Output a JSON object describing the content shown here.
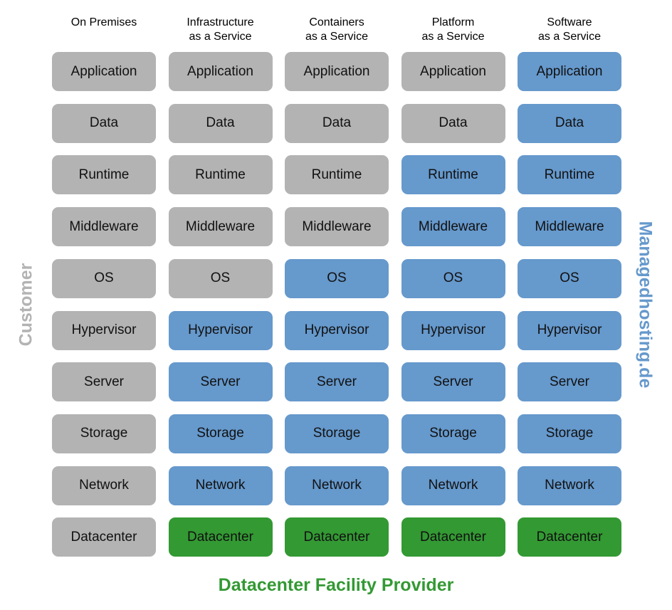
{
  "colors": {
    "customer": "#b3b3b3",
    "provider": "#6699cc",
    "facility": "#339933"
  },
  "columns": [
    {
      "title": [
        "On Premises"
      ],
      "cells": [
        "customer",
        "customer",
        "customer",
        "customer",
        "customer",
        "customer",
        "customer",
        "customer",
        "customer",
        "customer"
      ]
    },
    {
      "title": [
        "Infrastructure",
        "as a Service"
      ],
      "cells": [
        "customer",
        "customer",
        "customer",
        "customer",
        "customer",
        "provider",
        "provider",
        "provider",
        "provider",
        "facility"
      ]
    },
    {
      "title": [
        "Containers",
        "as a Service"
      ],
      "cells": [
        "customer",
        "customer",
        "customer",
        "customer",
        "provider",
        "provider",
        "provider",
        "provider",
        "provider",
        "facility"
      ]
    },
    {
      "title": [
        "Platform",
        "as a Service"
      ],
      "cells": [
        "customer",
        "customer",
        "provider",
        "provider",
        "provider",
        "provider",
        "provider",
        "provider",
        "provider",
        "facility"
      ]
    },
    {
      "title": [
        "Software",
        "as a Service"
      ],
      "cells": [
        "provider",
        "provider",
        "provider",
        "provider",
        "provider",
        "provider",
        "provider",
        "provider",
        "provider",
        "facility"
      ]
    }
  ],
  "layers": [
    "Application",
    "Data",
    "Runtime",
    "Middleware",
    "OS",
    "Hypervisor",
    "Server",
    "Storage",
    "Network",
    "Datacenter"
  ],
  "labels": {
    "customer": "Customer",
    "provider": "Managedhosting.de",
    "facility": "Datacenter Facility Provider"
  }
}
